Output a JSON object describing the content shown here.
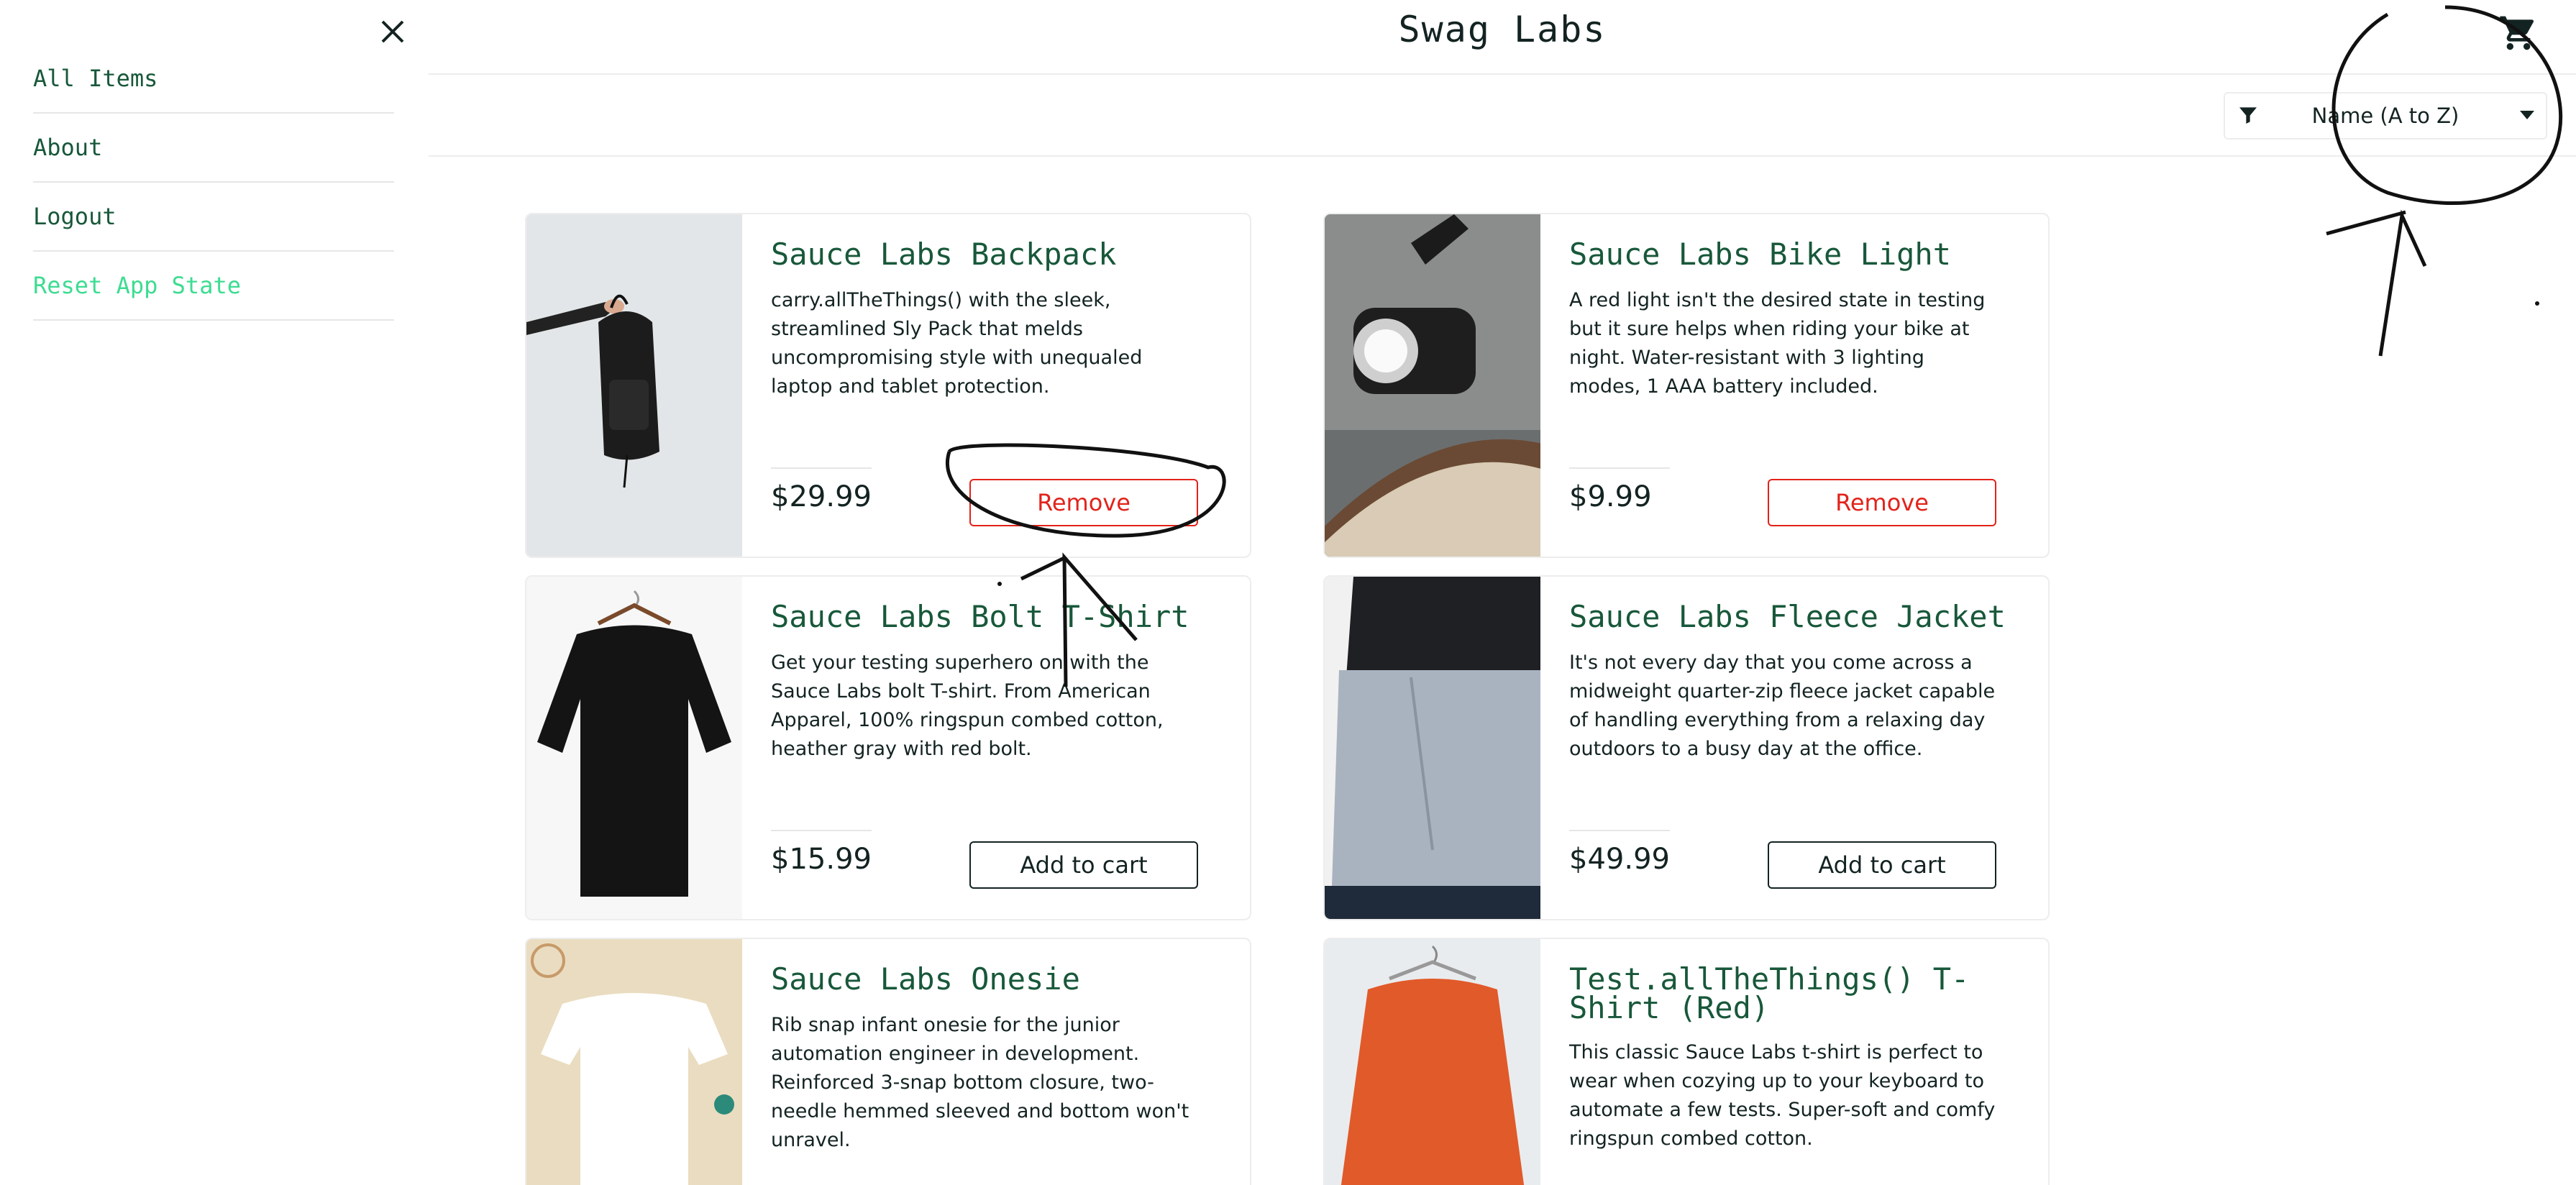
{
  "app": {
    "title": "Swag Labs"
  },
  "sidebar": {
    "items": [
      {
        "label": "All Items"
      },
      {
        "label": "About"
      },
      {
        "label": "Logout"
      },
      {
        "label": "Reset App State"
      }
    ]
  },
  "sort": {
    "selected": "Name (A to Z)"
  },
  "products": [
    {
      "name": "Sauce Labs Backpack",
      "description": "carry.allTheThings() with the sleek, streamlined Sly Pack that melds uncompromising style with unequaled laptop and tablet protection.",
      "price": "$29.99",
      "button": "Remove"
    },
    {
      "name": "Sauce Labs Bike Light",
      "description": "A red light isn't the desired state in testing but it sure helps when riding your bike at night. Water-resistant with 3 lighting modes, 1 AAA battery included.",
      "price": "$9.99",
      "button": "Remove"
    },
    {
      "name": "Sauce Labs Bolt T-Shirt",
      "description": "Get your testing superhero on with the Sauce Labs bolt T-shirt. From American Apparel, 100% ringspun combed cotton, heather gray with red bolt.",
      "price": "$15.99",
      "button": "Add to cart"
    },
    {
      "name": "Sauce Labs Fleece Jacket",
      "description": "It's not every day that you come across a midweight quarter-zip fleece jacket capable of handling everything from a relaxing day outdoors to a busy day at the office.",
      "price": "$49.99",
      "button": "Add to cart"
    },
    {
      "name": "Sauce Labs Onesie",
      "description": "Rib snap infant onesie for the junior automation engineer in development. Reinforced 3-snap bottom closure, two-needle hemmed sleeved and bottom won't unravel.",
      "price": "",
      "button": ""
    },
    {
      "name": "Test.allTheThings() T-Shirt (Red)",
      "description": "This classic Sauce Labs t-shirt is perfect to wear when cozying up to your keyboard to automate a few tests. Super-soft and comfy ringspun combed cotton.",
      "price": "",
      "button": ""
    }
  ],
  "colors": {
    "accent": "#18583a",
    "remove": "#e2231a",
    "reset_link": "#3ddc91"
  },
  "icons": {
    "close": "close-icon",
    "cart": "shopping-cart-icon",
    "sort": "filter-icon",
    "dropdown": "chevron-down-icon"
  }
}
